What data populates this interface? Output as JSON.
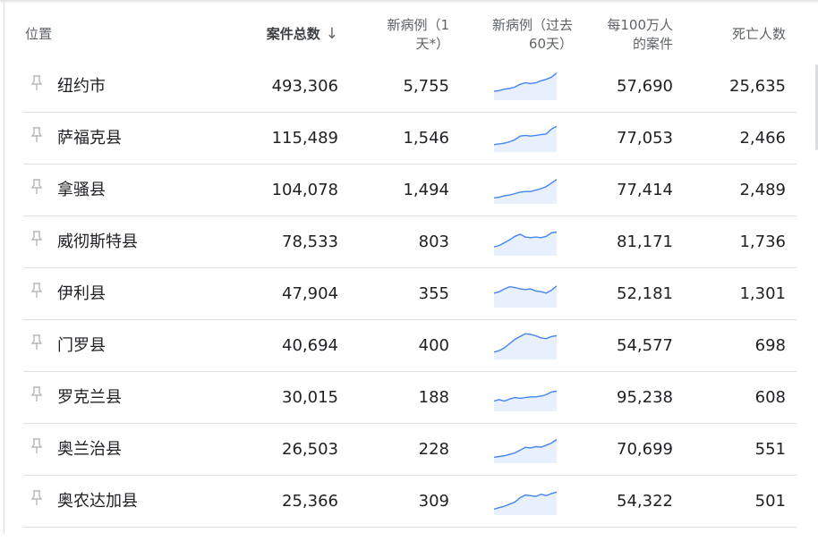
{
  "header": {
    "location": "位置",
    "total_cases": "案件总数",
    "new_cases_1d": "新病例（1天*）",
    "new_cases_60d": "新病例（过去60天）",
    "per_million": "每100万人的案件",
    "deaths": "死亡人数"
  },
  "rows": [
    {
      "name": "纽约市",
      "cases": "493,306",
      "new1": "5,755",
      "per": "57,690",
      "deaths": "25,635",
      "trend": [
        10,
        11,
        13,
        14,
        16,
        20,
        22,
        21,
        22,
        25,
        27,
        30,
        36
      ]
    },
    {
      "name": "萨福克县",
      "cases": "115,489",
      "new1": "1,546",
      "per": "77,053",
      "deaths": "2,466",
      "trend": [
        8,
        9,
        10,
        12,
        15,
        20,
        21,
        20,
        21,
        22,
        23,
        30,
        34
      ]
    },
    {
      "name": "拿骚县",
      "cases": "104,078",
      "new1": "1,494",
      "per": "77,414",
      "deaths": "2,489",
      "trend": [
        6,
        7,
        9,
        10,
        12,
        14,
        15,
        15,
        17,
        19,
        22,
        27,
        32
      ]
    },
    {
      "name": "威彻斯特县",
      "cases": "78,533",
      "new1": "803",
      "per": "81,171",
      "deaths": "1,736",
      "trend": [
        10,
        12,
        16,
        20,
        25,
        28,
        24,
        23,
        24,
        23,
        25,
        30,
        31
      ]
    },
    {
      "name": "伊利县",
      "cases": "47,904",
      "new1": "355",
      "per": "52,181",
      "deaths": "1,301",
      "trend": [
        18,
        20,
        24,
        27,
        26,
        24,
        23,
        24,
        21,
        20,
        18,
        22,
        28
      ]
    },
    {
      "name": "门罗县",
      "cases": "40,694",
      "new1": "400",
      "per": "54,577",
      "deaths": "698",
      "trend": [
        8,
        10,
        14,
        20,
        26,
        30,
        34,
        33,
        31,
        28,
        27,
        30,
        31
      ]
    },
    {
      "name": "罗克兰县",
      "cases": "30,015",
      "new1": "188",
      "per": "95,238",
      "deaths": "608",
      "trend": [
        12,
        14,
        12,
        15,
        17,
        16,
        17,
        18,
        18,
        19,
        21,
        25,
        26
      ]
    },
    {
      "name": "奥兰治县",
      "cases": "26,503",
      "new1": "228",
      "per": "70,699",
      "deaths": "551",
      "trend": [
        6,
        7,
        8,
        10,
        12,
        16,
        20,
        19,
        21,
        20,
        23,
        26,
        31
      ]
    },
    {
      "name": "奥农达加县",
      "cases": "25,366",
      "new1": "309",
      "per": "54,322",
      "deaths": "501",
      "trend": [
        6,
        8,
        10,
        13,
        16,
        22,
        26,
        25,
        24,
        27,
        25,
        28,
        30
      ]
    }
  ],
  "icons": {
    "pin": "pin-icon",
    "sort": "arrow-down-icon"
  },
  "colors": {
    "spark_line": "#4285f4",
    "spark_fill": "#e8f0fe"
  }
}
